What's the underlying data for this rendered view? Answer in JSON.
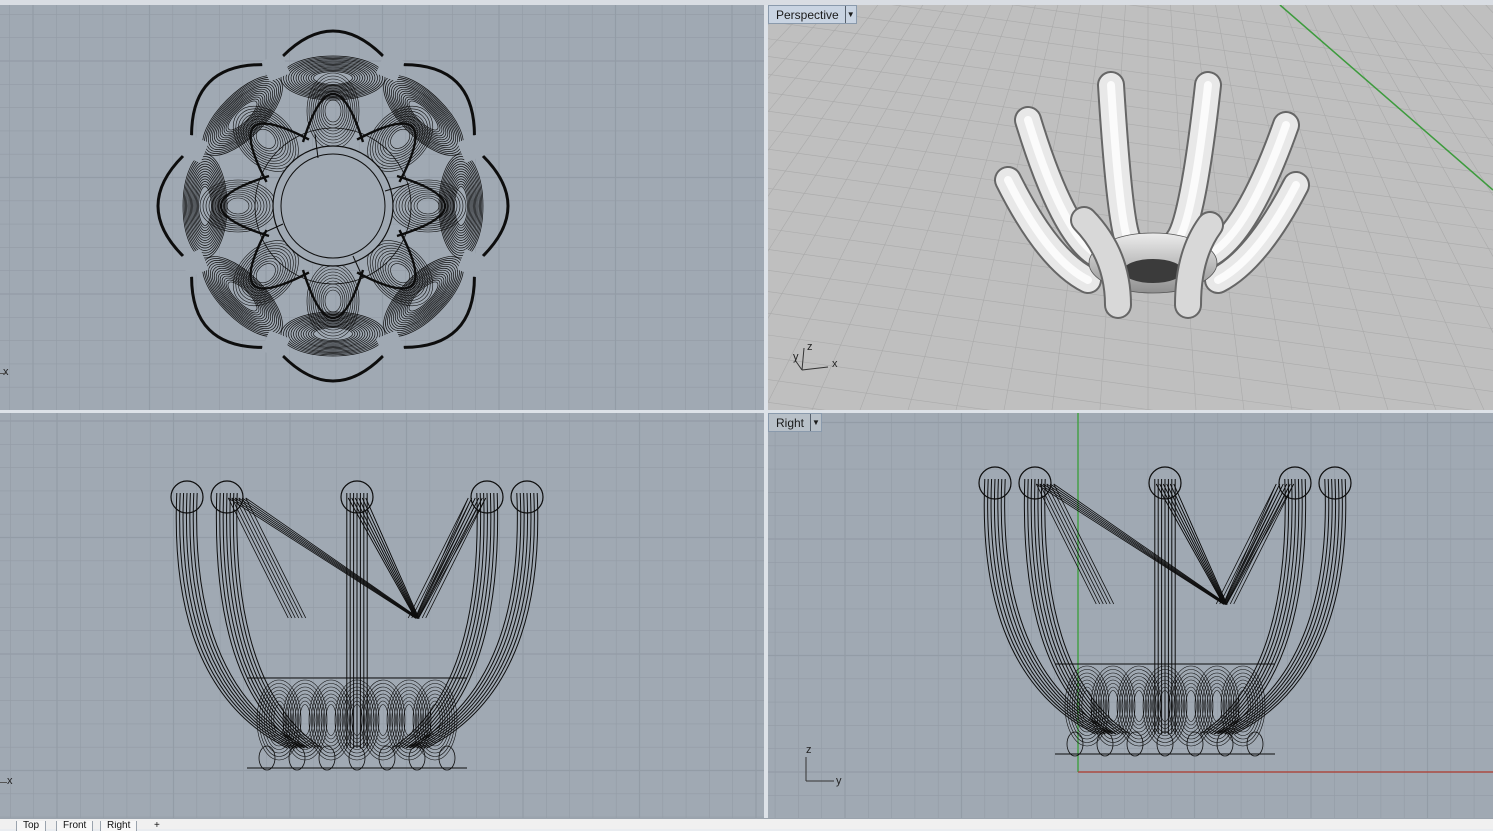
{
  "viewports": {
    "top": {
      "axis_x": "x"
    },
    "perspective": {
      "title": "Perspective",
      "axis_z": "z",
      "axis_y": "y",
      "axis_x": "x"
    },
    "front": {
      "axis_x": "x"
    },
    "right": {
      "title": "Right",
      "axis_z": "z",
      "axis_y": "y"
    }
  },
  "tabs": [
    "Top",
    "Front",
    "Right",
    "+"
  ],
  "colors": {
    "viewport_bg": "#a0a9b3",
    "perspective_bg": "#bfbfbf",
    "grid_minor": "#939ca6",
    "grid_major": "#8a939d",
    "x_axis": "#b03a2e",
    "y_axis": "#3aa03a",
    "wire": "#0d0d0d"
  },
  "icons": [
    "dropdown-arrow-icon",
    "axis-triad-icon"
  ]
}
